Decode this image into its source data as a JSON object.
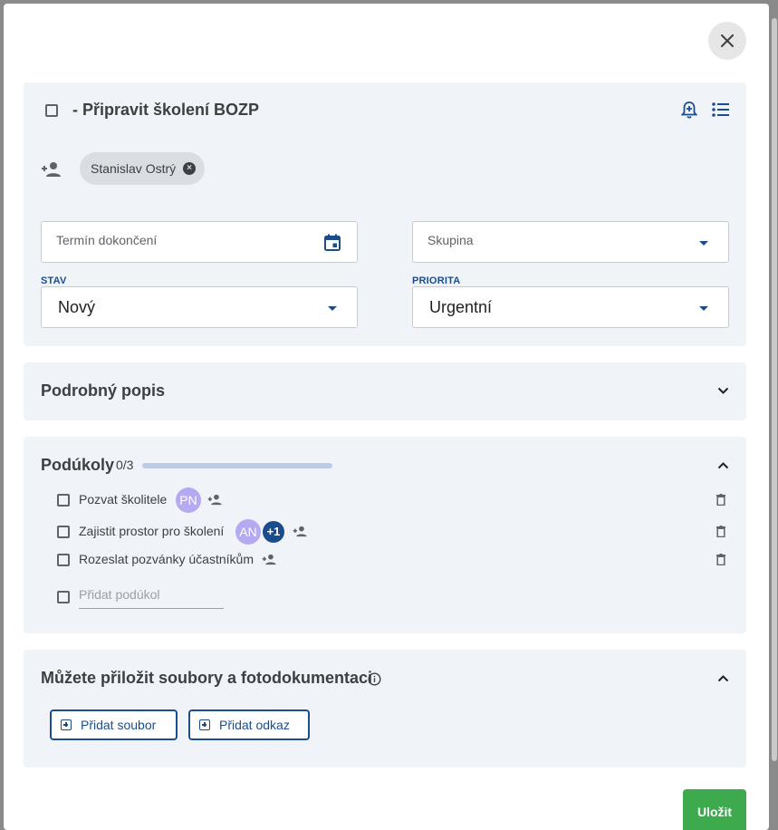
{
  "task": {
    "title": "- Připravit školení BOZP",
    "assignee": "Stanislav Ostrý",
    "due_placeholder": "Termín dokončení",
    "group_placeholder": "Skupina",
    "status_label": "STAV",
    "status_value": "Nový",
    "priority_label": "PRIORITA",
    "priority_value": "Urgentní"
  },
  "description": {
    "title": "Podrobný popis"
  },
  "subtasks": {
    "title": "Podúkoly",
    "count": "0/3",
    "progress": 0,
    "items": [
      {
        "label": "Pozvat školitele",
        "avatar": "PN"
      },
      {
        "label": "Zajistit prostor pro školení",
        "avatar": "AN",
        "more": "+1"
      },
      {
        "label": "Rozeslat pozvánky účastníkům"
      }
    ],
    "add_placeholder": "Přidat podúkol"
  },
  "attachments": {
    "title": "Můžete přiložit soubory a fotodokumentaci",
    "add_file": "Přidat soubor",
    "add_link": "Přidat odkaz"
  },
  "footer": {
    "save": "Uložit"
  },
  "colors": {
    "accent": "#1b4d8c",
    "save": "#3eaa4e",
    "card": "#f0f4f9",
    "avatar": "#b5aaf2"
  }
}
